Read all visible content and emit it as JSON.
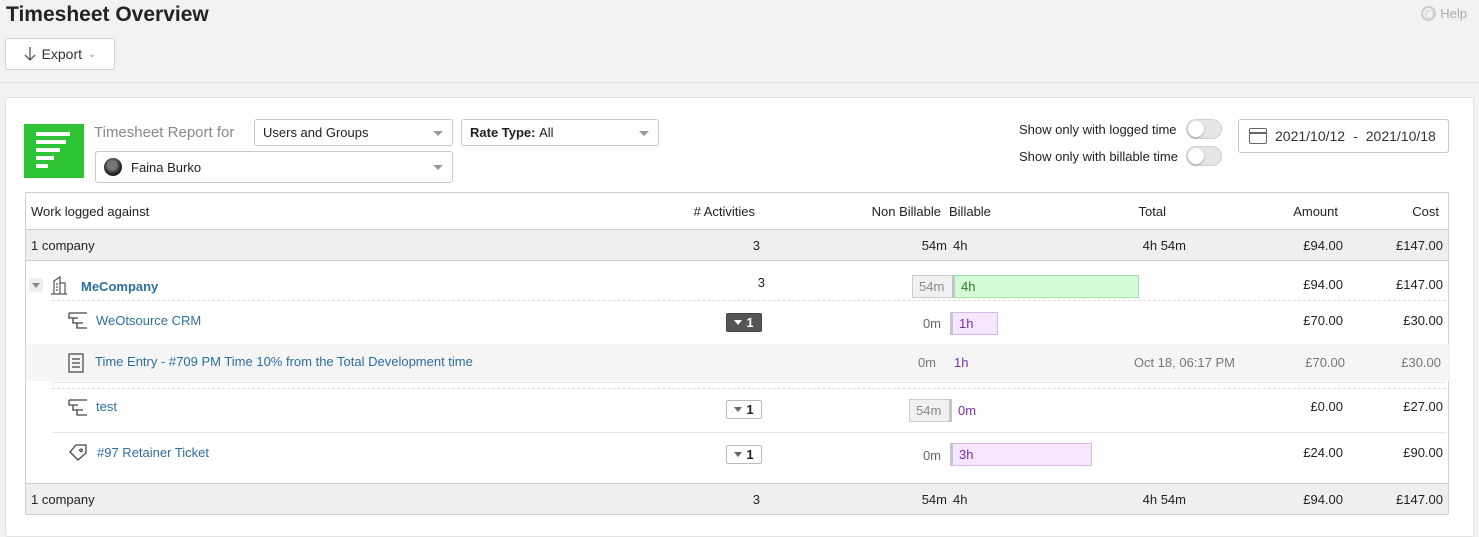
{
  "page": {
    "title": "Timesheet Overview",
    "help_label": "Help"
  },
  "toolbar": {
    "export_label": "Export"
  },
  "report": {
    "label": "Timesheet Report for",
    "users_select": "Users and Groups",
    "rate_type_label": "Rate Type:",
    "rate_type_value": "All",
    "user_select": "Faina Burko"
  },
  "filters": {
    "logged_time_label": "Show only with logged time",
    "billable_time_label": "Show only with billable time",
    "logged_time_on": false,
    "billable_time_on": false,
    "date_from": "2021/10/12",
    "date_sep": "-",
    "date_to": "2021/10/18"
  },
  "table": {
    "headers": {
      "work": "Work logged against",
      "activities": "# Activities",
      "non_billable": "Non Billable",
      "billable": "Billable",
      "total": "Total",
      "amount": "Amount",
      "cost": "Cost"
    },
    "summary_top": {
      "label": "1 company",
      "activities": "3",
      "non_billable": "54m",
      "billable": "4h",
      "total": "4h 54m",
      "amount": "£94.00",
      "cost": "£147.00"
    },
    "company": {
      "name": "MeCompany",
      "activities": "3",
      "non_billable": "54m",
      "billable": "4h",
      "amount": "£94.00",
      "cost": "£147.00"
    },
    "items": [
      {
        "name": "WeOtsource CRM",
        "activities": "1",
        "non_billable": "0m",
        "billable": "1h",
        "amount": "£70.00",
        "cost": "£30.00"
      },
      {
        "name": "test",
        "activities": "1",
        "non_billable": "54m",
        "billable": "0m",
        "amount": "£0.00",
        "cost": "£27.00"
      },
      {
        "name": "#97 Retainer Ticket",
        "activities": "1",
        "non_billable": "0m",
        "billable": "3h",
        "amount": "£24.00",
        "cost": "£90.00"
      }
    ],
    "entry": {
      "name": "Time Entry - #709 PM Time 10% from the Total Development time",
      "non_billable": "0m",
      "billable": "1h",
      "date": "Oct 18, 06:17 PM",
      "amount": "£70.00",
      "cost": "£30.00"
    },
    "summary_bottom": {
      "label": "1 company",
      "activities": "3",
      "non_billable": "54m",
      "billable": "4h",
      "total": "4h 54m",
      "amount": "£94.00",
      "cost": "£147.00"
    }
  },
  "colors": {
    "brand_green": "#2ec433",
    "link": "#2e6e9e",
    "billable_green": "#d4fad7",
    "billable_purple": "#f5e6fd"
  }
}
